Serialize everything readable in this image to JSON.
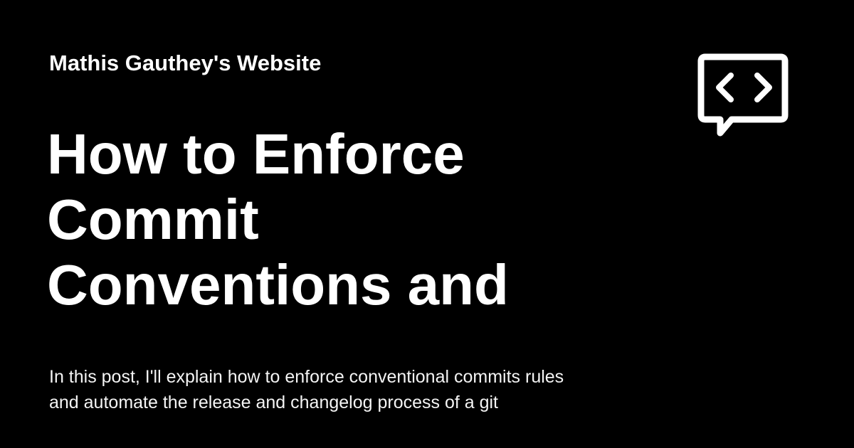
{
  "site": {
    "name": "Mathis Gauthey's Website",
    "logo_icon": "code-speech-bubble-icon"
  },
  "post": {
    "title_lines": [
      "How to Enforce",
      "Commit",
      "Conventions and"
    ],
    "description_lines": [
      "In this post, I'll explain how to enforce conventional commits rules",
      "and automate the release and changelog process of a git"
    ]
  },
  "colors": {
    "background": "#000000",
    "foreground": "#ffffff"
  }
}
